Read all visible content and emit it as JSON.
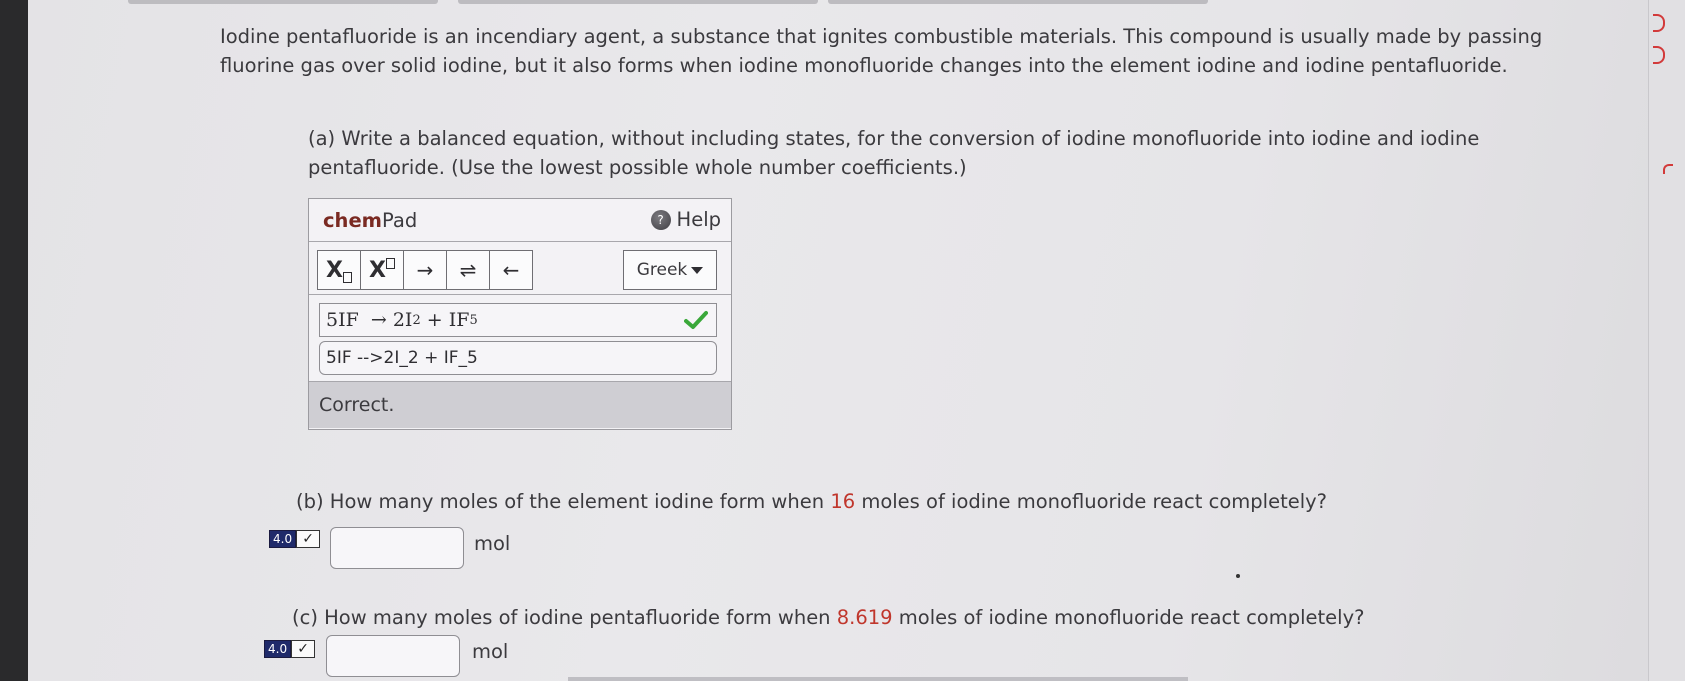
{
  "intro_text": "Iodine pentafluoride is an incendiary agent, a substance that ignites combustible materials. This compound is usually made by passing fluorine gas over solid iodine, but it also forms when iodine monofluoride changes into the element iodine and iodine pentafluoride.",
  "part_a": {
    "text": "(a) Write a balanced equation, without including states, for the conversion of iodine monofluoride into iodine and iodine pentafluoride. (Use the lowest possible whole number coefficients.)"
  },
  "chempad": {
    "title_bold": "chem",
    "title_rest": "Pad",
    "help_label": "Help",
    "help_icon_glyph": "?",
    "tools": {
      "subscript_label": "X",
      "superscript_label": "X",
      "arrow_right": "→",
      "equilibrium": "⇌",
      "arrow_left": "←"
    },
    "greek_label": "Greek",
    "display_equation": {
      "coef1": "5IF",
      "arrow": "→",
      "coef2": "2I",
      "sub2": "2",
      "plus": "+",
      "prod": "IF",
      "sub5": "5"
    },
    "input_value": "5IF -->2I_2 + IF_5",
    "status": "Correct."
  },
  "part_b": {
    "prefix": "(b) How many moles of the element iodine form when ",
    "amount": "16",
    "suffix": " moles of iodine monofluoride react completely?",
    "badge": "4.0",
    "badge_check": "✓",
    "answer_value": "",
    "unit": "mol"
  },
  "part_c": {
    "prefix": "(c) How many moles of iodine pentafluoride form when ",
    "amount": "8.619",
    "suffix": " moles of iodine monofluoride react completely?",
    "badge": "4.0",
    "badge_check": "✓",
    "answer_value": "",
    "unit": "mol"
  },
  "colors": {
    "highlight_red": "#c0362c",
    "check_green": "#3aa83a",
    "badge_navy": "#1f2a6a"
  }
}
